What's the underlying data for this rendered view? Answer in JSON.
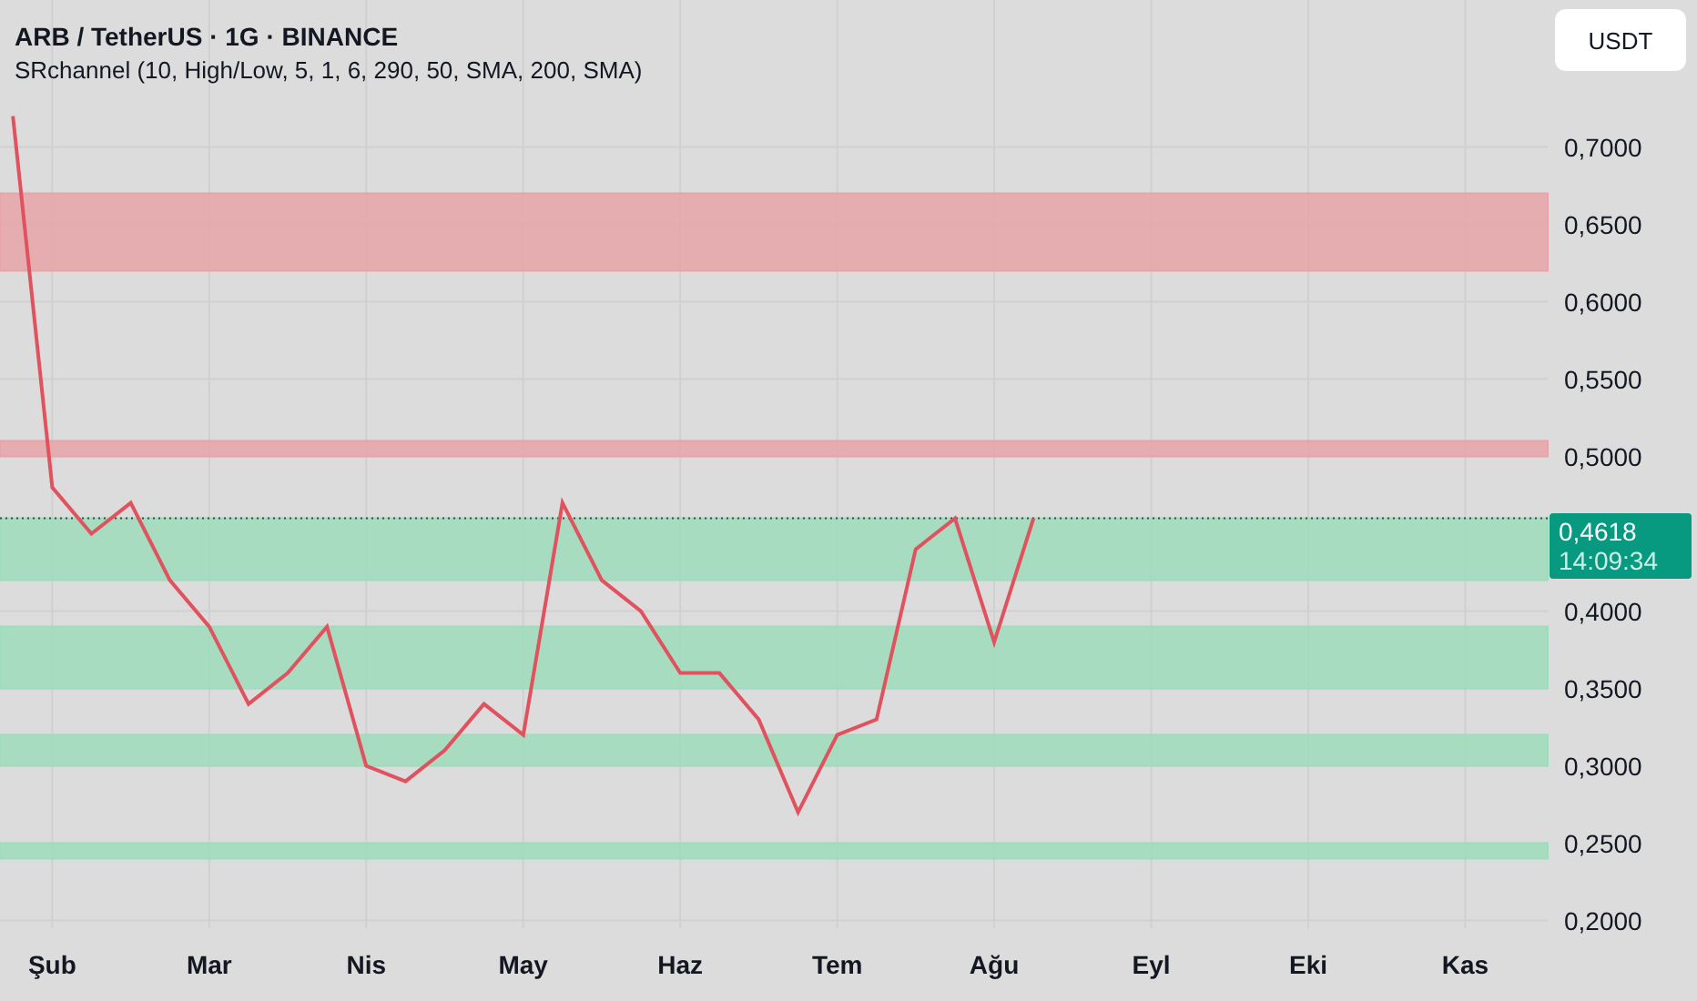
{
  "header": {
    "title": "ARB / TetherUS · 1G · BINANCE",
    "indicator": "SRchannel (10, High/Low, 5, 1, 6, 290, 50, SMA, 200, SMA)"
  },
  "currency_button": "USDT",
  "price_label": {
    "price": "0,4618",
    "countdown": "14:09:34"
  },
  "chart_data": {
    "type": "line",
    "categories": [
      null,
      "Şub",
      null,
      null,
      null,
      "Mar",
      null,
      null,
      null,
      "Nis",
      null,
      null,
      null,
      "May",
      null,
      null,
      null,
      "Haz",
      null,
      null,
      null,
      "Tem",
      null,
      null,
      null,
      "Ağu",
      null,
      null,
      null,
      "Eyl",
      null,
      null,
      null,
      "Eki",
      null,
      null,
      null,
      "Kas",
      null,
      null
    ],
    "series": [
      {
        "color": "#e0525e",
        "values": [
          0.72,
          0.48,
          0.45,
          0.47,
          0.42,
          0.39,
          0.34,
          0.36,
          0.39,
          0.3,
          0.29,
          0.31,
          0.34,
          0.32,
          0.47,
          0.42,
          0.4,
          0.36,
          0.36,
          0.33,
          0.27,
          0.32,
          0.33,
          0.44,
          0.46,
          0.38,
          0.46,
          null,
          null,
          null,
          null,
          null,
          null,
          null,
          null,
          null,
          null,
          null,
          null,
          null
        ]
      }
    ],
    "ylim": [
      0.195,
      0.795
    ],
    "yticks": [
      {
        "value": 0.2,
        "label": "0,2000"
      },
      {
        "value": 0.25,
        "label": "0,2500"
      },
      {
        "value": 0.3,
        "label": "0,3000"
      },
      {
        "value": 0.35,
        "label": "0,3500"
      },
      {
        "value": 0.4,
        "label": "0,4000"
      },
      {
        "value": 0.5,
        "label": "0,5000"
      },
      {
        "value": 0.55,
        "label": "0,5500"
      },
      {
        "value": 0.6,
        "label": "0,6000"
      },
      {
        "value": 0.65,
        "label": "0,6500"
      },
      {
        "value": 0.7,
        "label": "0,7000"
      }
    ],
    "grid": true,
    "bands": [
      {
        "axis": "y",
        "from": 0.62,
        "to": 0.67,
        "color": "#e8a4a8"
      },
      {
        "axis": "y",
        "from": 0.5,
        "to": 0.51,
        "color": "#e8a4a8"
      },
      {
        "axis": "y",
        "from": 0.42,
        "to": 0.46,
        "color": "#9fdcbc"
      },
      {
        "axis": "y",
        "from": 0.35,
        "to": 0.39,
        "color": "#9fdcbc"
      },
      {
        "axis": "y",
        "from": 0.3,
        "to": 0.32,
        "color": "#9fdcbc"
      },
      {
        "axis": "y",
        "from": 0.24,
        "to": 0.25,
        "color": "#9fdcbc"
      }
    ],
    "ref_lines": [
      {
        "axis": "y",
        "value": 0.46,
        "color": "#444444"
      }
    ]
  }
}
